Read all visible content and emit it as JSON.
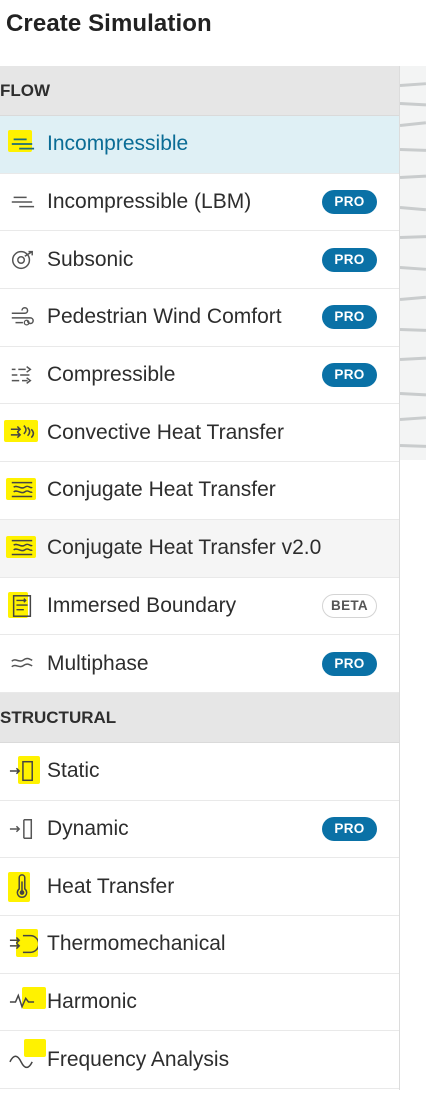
{
  "page_title": "Create Simulation",
  "sections": [
    {
      "label": "FLOW",
      "items": [
        {
          "label": "Incompressible",
          "icon": "incompressible-icon",
          "selected": true,
          "highlight": true
        },
        {
          "label": "Incompressible (LBM)",
          "icon": "incompressible-lbm-icon",
          "badge": "PRO"
        },
        {
          "label": "Subsonic",
          "icon": "subsonic-icon",
          "badge": "PRO"
        },
        {
          "label": "Pedestrian Wind Comfort",
          "icon": "wind-comfort-icon",
          "badge": "PRO"
        },
        {
          "label": "Compressible",
          "icon": "compressible-icon",
          "badge": "PRO"
        },
        {
          "label": "Convective Heat Transfer",
          "icon": "convective-heat-icon",
          "highlight": true
        },
        {
          "label": "Conjugate Heat Transfer",
          "icon": "conjugate-heat-icon",
          "highlight": true
        },
        {
          "label": "Conjugate Heat Transfer v2.0",
          "icon": "conjugate-heat-v2-icon",
          "highlight": true,
          "hovered": true
        },
        {
          "label": "Immersed Boundary",
          "icon": "immersed-boundary-icon",
          "badge": "BETA",
          "highlight": true
        },
        {
          "label": "Multiphase",
          "icon": "multiphase-icon",
          "badge": "PRO"
        }
      ]
    },
    {
      "label": "STRUCTURAL",
      "items": [
        {
          "label": "Static",
          "icon": "static-icon",
          "highlight": true
        },
        {
          "label": "Dynamic",
          "icon": "dynamic-icon",
          "badge": "PRO"
        },
        {
          "label": "Heat Transfer",
          "icon": "thermometer-icon",
          "highlight": true
        },
        {
          "label": "Thermomechanical",
          "icon": "thermomechanical-icon",
          "highlight": true
        },
        {
          "label": "Harmonic",
          "icon": "harmonic-icon",
          "highlight": true
        },
        {
          "label": "Frequency Analysis",
          "icon": "frequency-icon",
          "highlight": true
        }
      ]
    }
  ],
  "colors": {
    "accent": "#0a71a6",
    "selected_bg": "#dff0f5",
    "selected_text": "#0a6c95",
    "section_bg": "#e6e6e6",
    "highlight": "#fff200"
  }
}
